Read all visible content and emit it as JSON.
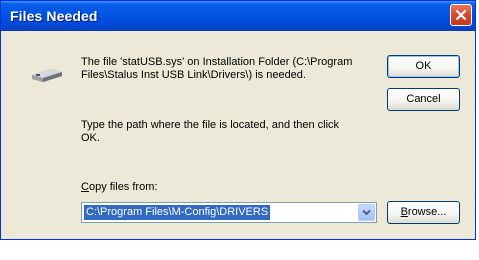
{
  "window": {
    "title": "Files Needed"
  },
  "dialog": {
    "message": "The file 'statUSB.sys' on Installation Folder (C:\\Program Files\\Stalus Inst USB Link\\Drivers\\) is needed.",
    "instruction": "Type the path where the file is located, and then click OK.",
    "copy_label_mnemonic": "C",
    "copy_label_rest": "opy files from:",
    "path_value": "C:\\Program Files\\M-Config\\DRIVERS"
  },
  "buttons": {
    "ok_label": "OK",
    "cancel_label": "Cancel",
    "browse_mnemonic": "B",
    "browse_rest": "rowse..."
  },
  "icons": {
    "device": "usb-device-icon",
    "close": "close-icon",
    "dropdown": "chevron-down-icon"
  },
  "colors": {
    "titlebar": "#0054e3",
    "dialog_bg": "#ece9d8",
    "selection": "#316ac5",
    "close_button": "#d9482a"
  }
}
